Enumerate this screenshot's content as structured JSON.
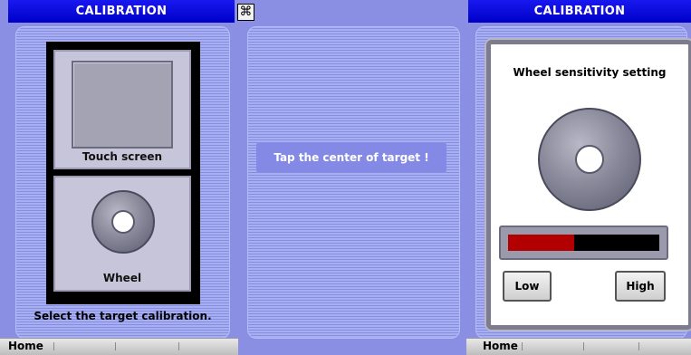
{
  "left_panel": {
    "title": "CALIBRATION",
    "options": [
      {
        "label": "Touch screen"
      },
      {
        "label": "Wheel"
      }
    ],
    "caption": "Select the target calibration.",
    "home_label": "Home"
  },
  "middle_panel": {
    "close_glyph": "⌘",
    "tap_text": "Tap the center of target !"
  },
  "right_panel": {
    "title": "CALIBRATION",
    "card_title": "Wheel sensitivity setting",
    "sensitivity_fraction": 0.44,
    "low_label": "Low",
    "high_label": "High",
    "home_label": "Home"
  },
  "colors": {
    "title_bar": "#0000d8",
    "slider_fill": "#b20000"
  }
}
